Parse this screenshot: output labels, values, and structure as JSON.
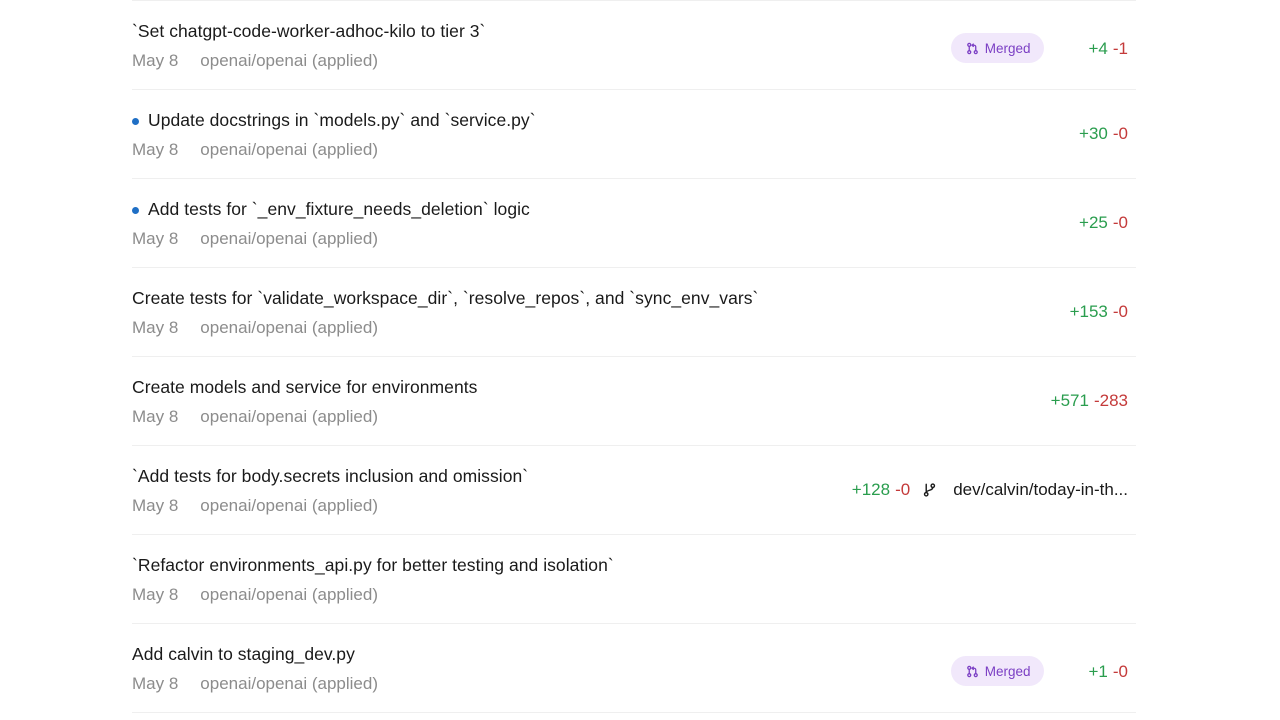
{
  "rows": [
    {
      "title": "`Set chatgpt-code-worker-adhoc-kilo to tier 3`",
      "unread": false,
      "date": "May 8",
      "repo": "openai/openai (applied)",
      "badge": "Merged",
      "additions": "+4",
      "deletions": "-1",
      "branch": ""
    },
    {
      "title": "Update docstrings in `models.py` and `service.py`",
      "unread": true,
      "date": "May 8",
      "repo": "openai/openai (applied)",
      "badge": "",
      "additions": "+30",
      "deletions": "-0",
      "branch": ""
    },
    {
      "title": "Add tests for `_env_fixture_needs_deletion` logic",
      "unread": true,
      "date": "May 8",
      "repo": "openai/openai (applied)",
      "badge": "",
      "additions": "+25",
      "deletions": "-0",
      "branch": ""
    },
    {
      "title": "Create tests for `validate_workspace_dir`, `resolve_repos`, and `sync_env_vars`",
      "unread": false,
      "date": "May 8",
      "repo": "openai/openai (applied)",
      "badge": "",
      "additions": "+153",
      "deletions": "-0",
      "branch": ""
    },
    {
      "title": "Create models and service for environments",
      "unread": false,
      "date": "May 8",
      "repo": "openai/openai (applied)",
      "badge": "",
      "additions": "+571",
      "deletions": "-283",
      "branch": ""
    },
    {
      "title": "`Add tests for body.secrets inclusion and omission`",
      "unread": false,
      "date": "May 8",
      "repo": "openai/openai (applied)",
      "badge": "",
      "additions": "+128",
      "deletions": "-0",
      "branch": "dev/calvin/today-in-th..."
    },
    {
      "title": "`Refactor environments_api.py for better testing and isolation`",
      "unread": false,
      "date": "May 8",
      "repo": "openai/openai (applied)",
      "badge": "",
      "additions": "",
      "deletions": "",
      "branch": ""
    },
    {
      "title": "Add calvin to staging_dev.py",
      "unread": false,
      "date": "May 8",
      "repo": "openai/openai (applied)",
      "badge": "Merged",
      "additions": "+1",
      "deletions": "-0",
      "branch": ""
    }
  ],
  "colors": {
    "additions": "#2a9d4e",
    "deletions": "#c43a3a",
    "merged_badge_bg": "#f1e8fb",
    "merged_badge_text": "#7b3fc4",
    "unread_dot": "#1f6fc5"
  },
  "icons": {
    "merged": "pull-request-icon",
    "branch": "git-branch-icon",
    "unread": "unread-dot-icon"
  }
}
